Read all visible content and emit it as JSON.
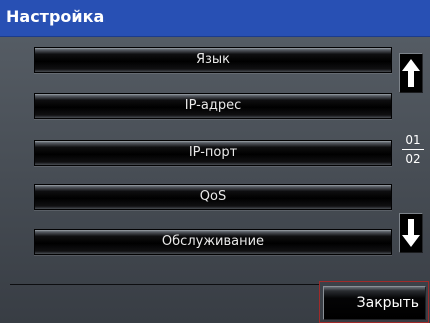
{
  "window": {
    "title": "Настройка"
  },
  "menu": {
    "items": [
      {
        "label": "Язык"
      },
      {
        "label": "IP-адрес"
      },
      {
        "label": "IP-порт"
      },
      {
        "label": "QoS"
      },
      {
        "label": "Обслуживание"
      }
    ]
  },
  "pager": {
    "current": "01",
    "total": "02"
  },
  "icons": {
    "up": "arrow-up-icon",
    "down": "arrow-down-icon"
  },
  "actions": {
    "close_label": "Закрыть"
  },
  "colors": {
    "title_bar": "#2850b4",
    "panel": "#4a5058",
    "close_outline": "#a02a2a"
  }
}
